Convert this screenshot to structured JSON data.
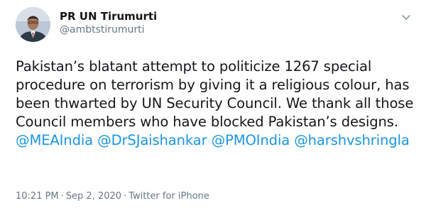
{
  "author": {
    "display_name": "PR UN Tirumurti",
    "handle": "@ambtstirumurti"
  },
  "tweet": {
    "text_part1": "Pakistan’s blatant attempt to politicize 1267 special procedure on terrorism by giving it a religious colour, has been thwarted by UN Security Council. We thank all those Council members who have blocked Pakistan’s designs. ",
    "mentions": [
      "@MEAIndia",
      "@DrSJaishankar",
      "@PMOIndia",
      "@harshvshringla"
    ]
  },
  "meta": {
    "time": "10:21 PM",
    "separator": "·",
    "date": "Sep 2, 2020",
    "source": "Twitter for iPhone"
  },
  "icons": {
    "more": "chevron-down-icon",
    "avatar": "avatar"
  },
  "colors": {
    "link": "#1b95e0",
    "text": "#14171a",
    "secondary": "#657786"
  }
}
